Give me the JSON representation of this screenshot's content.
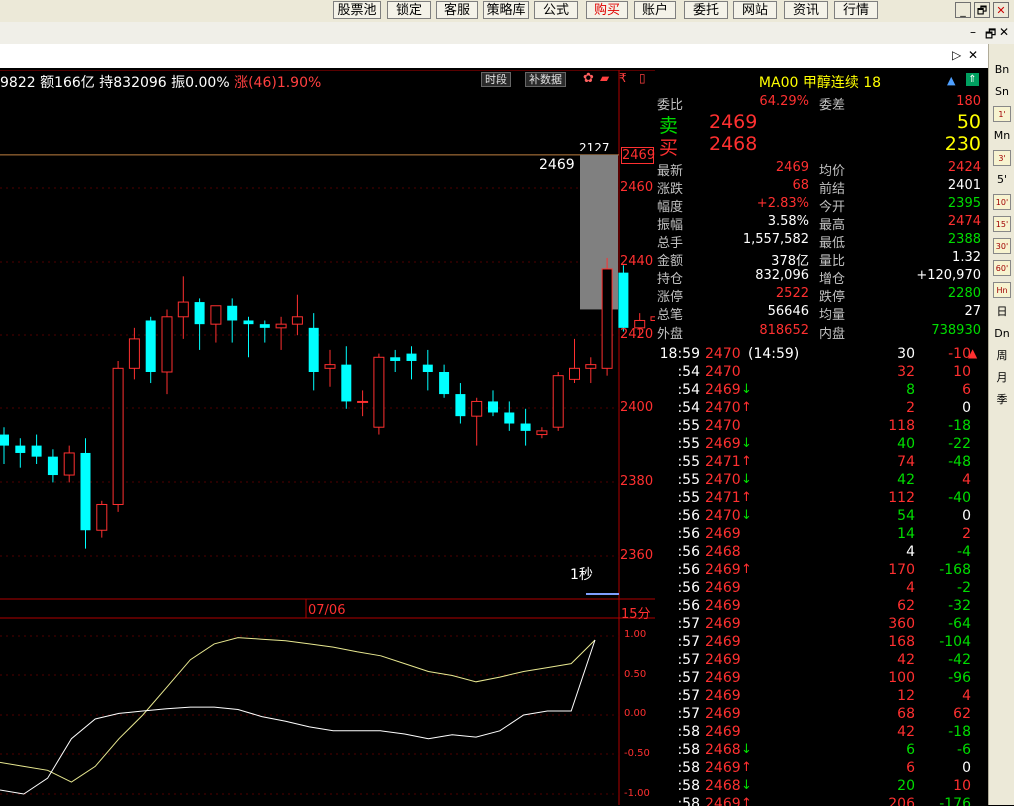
{
  "toolbar": {
    "buttons": [
      "股票池",
      "锁定",
      "客服",
      "策略库",
      "公式",
      "购买",
      "账户",
      "委托",
      "网站",
      "资讯",
      "行情"
    ],
    "active_color": "#e00000"
  },
  "window_controls": {
    "minimize": "_",
    "restore": "🗗",
    "close": "✕"
  },
  "panel_controls": {
    "play": "▷",
    "close": "✕"
  },
  "info_line": {
    "text": "9822 额166亿 持832096 振0.00%",
    "change": "涨(46)1.90%"
  },
  "chart_buttons": {
    "time_period": "时段",
    "supplement": "补数据"
  },
  "price_axis": [
    "2460",
    "2440",
    "2420",
    "2400",
    "2380",
    "2360"
  ],
  "current_price_tag": "2469",
  "price_label": "2469",
  "cut_label": "2127",
  "date_label": "07/06",
  "period_label": "15分",
  "interval_label": "1秒",
  "osc_axis": [
    "1.00",
    "0.50",
    "0.00",
    "-0.50",
    "-1.00"
  ],
  "chart_data": {
    "type": "candlestick",
    "candles": [
      {
        "o": 2393,
        "h": 2395,
        "l": 2385,
        "c": 2390
      },
      {
        "o": 2390,
        "h": 2392,
        "l": 2384,
        "c": 2388
      },
      {
        "o": 2390,
        "h": 2393,
        "l": 2385,
        "c": 2387
      },
      {
        "o": 2387,
        "h": 2389,
        "l": 2380,
        "c": 2382
      },
      {
        "o": 2382,
        "h": 2390,
        "l": 2380,
        "c": 2388
      },
      {
        "o": 2388,
        "h": 2392,
        "l": 2362,
        "c": 2367
      },
      {
        "o": 2367,
        "h": 2375,
        "l": 2365,
        "c": 2374
      },
      {
        "o": 2374,
        "h": 2413,
        "l": 2372,
        "c": 2411
      },
      {
        "o": 2411,
        "h": 2422,
        "l": 2408,
        "c": 2419
      },
      {
        "o": 2424,
        "h": 2425,
        "l": 2407,
        "c": 2410
      },
      {
        "o": 2410,
        "h": 2427,
        "l": 2404,
        "c": 2425
      },
      {
        "o": 2425,
        "h": 2436,
        "l": 2419,
        "c": 2429
      },
      {
        "o": 2429,
        "h": 2430,
        "l": 2416,
        "c": 2423
      },
      {
        "o": 2423,
        "h": 2428,
        "l": 2418,
        "c": 2428
      },
      {
        "o": 2428,
        "h": 2430,
        "l": 2418,
        "c": 2424
      },
      {
        "o": 2424,
        "h": 2425,
        "l": 2414,
        "c": 2423
      },
      {
        "o": 2423,
        "h": 2424,
        "l": 2418,
        "c": 2422
      },
      {
        "o": 2422,
        "h": 2425,
        "l": 2416,
        "c": 2423
      },
      {
        "o": 2423,
        "h": 2431,
        "l": 2420,
        "c": 2425
      },
      {
        "o": 2422,
        "h": 2426,
        "l": 2405,
        "c": 2410
      },
      {
        "o": 2411,
        "h": 2416,
        "l": 2406,
        "c": 2412
      },
      {
        "o": 2412,
        "h": 2417,
        "l": 2400,
        "c": 2402
      },
      {
        "o": 2402,
        "h": 2405,
        "l": 2398,
        "c": 2402
      },
      {
        "o": 2395,
        "h": 2415,
        "l": 2393,
        "c": 2414
      },
      {
        "o": 2414,
        "h": 2416,
        "l": 2410,
        "c": 2413
      },
      {
        "o": 2415,
        "h": 2417,
        "l": 2408,
        "c": 2413
      },
      {
        "o": 2412,
        "h": 2416,
        "l": 2405,
        "c": 2410
      },
      {
        "o": 2410,
        "h": 2412,
        "l": 2403,
        "c": 2404
      },
      {
        "o": 2404,
        "h": 2407,
        "l": 2396,
        "c": 2398
      },
      {
        "o": 2398,
        "h": 2403,
        "l": 2390,
        "c": 2402
      },
      {
        "o": 2402,
        "h": 2405,
        "l": 2398,
        "c": 2399
      },
      {
        "o": 2399,
        "h": 2402,
        "l": 2394,
        "c": 2396
      },
      {
        "o": 2396,
        "h": 2400,
        "l": 2390,
        "c": 2394
      },
      {
        "o": 2393,
        "h": 2395,
        "l": 2392,
        "c": 2394
      },
      {
        "o": 2395,
        "h": 2410,
        "l": 2394,
        "c": 2409
      },
      {
        "o": 2408,
        "h": 2419,
        "l": 2407,
        "c": 2411
      },
      {
        "o": 2411,
        "h": 2414,
        "l": 2407,
        "c": 2412
      },
      {
        "o": 2411,
        "h": 2441,
        "l": 2409,
        "c": 2438
      },
      {
        "o": 2437,
        "h": 2439,
        "l": 2421,
        "c": 2422
      },
      {
        "o": 2422,
        "h": 2426,
        "l": 2420,
        "c": 2424
      },
      {
        "o": 2424,
        "h": 2428,
        "l": 2420,
        "c": 2425
      },
      {
        "o": 2425,
        "h": 2426,
        "l": 2421,
        "c": 2422
      }
    ],
    "current_price": 2469,
    "oscillator": {
      "yellow_line": [
        -0.6,
        -0.65,
        -0.7,
        -0.85,
        -0.65,
        -0.3,
        0.0,
        0.35,
        0.7,
        0.9,
        0.98,
        0.96,
        0.94,
        0.9,
        0.86,
        0.8,
        0.75,
        0.65,
        0.55,
        0.5,
        0.42,
        0.48,
        0.55,
        0.6,
        0.65,
        0.95
      ],
      "white_line": [
        -0.95,
        -1.0,
        -0.8,
        -0.3,
        -0.05,
        0.02,
        0.05,
        0.08,
        0.1,
        0.1,
        0.07,
        -0.02,
        -0.08,
        -0.15,
        -0.2,
        -0.2,
        -0.2,
        -0.24,
        -0.3,
        -0.25,
        -0.28,
        -0.2,
        0.0,
        0.05,
        0.05,
        0.95
      ],
      "ylim": [
        -1.0,
        1.0
      ]
    }
  },
  "quote": {
    "title": "MA00  甲醇连续 18",
    "weibi_label": "委比",
    "weibi_value": "64.29%",
    "weicha_label": "委差",
    "weicha_value": "180",
    "sell_label": "卖",
    "sell_price": "2469",
    "sell_vol": "50",
    "buy_label": "买",
    "buy_price": "2468",
    "buy_vol": "230",
    "rows": [
      {
        "l1": "最新",
        "v1": "2469",
        "c1": "#ff3030",
        "l2": "均价",
        "v2": "2424",
        "c2": "#ff3030"
      },
      {
        "l1": "涨跌",
        "v1": "68",
        "c1": "#ff3030",
        "l2": "前结",
        "v2": "2401",
        "c2": "#ffffff"
      },
      {
        "l1": "幅度",
        "v1": "+2.83%",
        "c1": "#ff3030",
        "l2": "今开",
        "v2": "2395",
        "c2": "#00dd00"
      },
      {
        "l1": "振幅",
        "v1": "3.58%",
        "c1": "#ffffff",
        "l2": "最高",
        "v2": "2474",
        "c2": "#ff3030"
      },
      {
        "l1": "总手",
        "v1": "1,557,582",
        "c1": "#ffffff",
        "l2": "最低",
        "v2": "2388",
        "c2": "#00dd00"
      },
      {
        "l1": "金额",
        "v1": "378亿",
        "c1": "#ffffff",
        "l2": "量比",
        "v2": "1.32",
        "c2": "#ffffff"
      },
      {
        "l1": "持仓",
        "v1": "832,096",
        "c1": "#ffffff",
        "l2": "增仓",
        "v2": "+120,970",
        "c2": "#ffffff"
      },
      {
        "l1": "涨停",
        "v1": "2522",
        "c1": "#ff3030",
        "l2": "跌停",
        "v2": "2280",
        "c2": "#00dd00"
      },
      {
        "l1": "总笔",
        "v1": "56646",
        "c1": "#ffffff",
        "l2": "均量",
        "v2": "27",
        "c2": "#ffffff"
      }
    ],
    "outer_label": "外盘",
    "outer_value": "818652",
    "inner_label": "内盘",
    "inner_value": "738930"
  },
  "ticks": [
    {
      "t": "18:59",
      "p": "2470",
      "extra": "(14:59)",
      "v": "30",
      "o": "-10",
      "vc": "#ffffff",
      "oc": "#ff3030"
    },
    {
      "t": ":54",
      "p": "2470",
      "a": "",
      "v": "32",
      "o": "10",
      "vc": "#ff3030",
      "oc": "#ff3030"
    },
    {
      "t": ":54",
      "p": "2469",
      "a": "↓",
      "v": "8",
      "o": "6",
      "vc": "#00dd00",
      "oc": "#ff3030"
    },
    {
      "t": ":54",
      "p": "2470",
      "a": "↑",
      "v": "2",
      "o": "0",
      "vc": "#ff3030",
      "oc": "#ffffff"
    },
    {
      "t": ":55",
      "p": "2470",
      "a": "",
      "v": "118",
      "o": "-18",
      "vc": "#ff3030",
      "oc": "#00dd00"
    },
    {
      "t": ":55",
      "p": "2469",
      "a": "↓",
      "v": "40",
      "o": "-22",
      "vc": "#00dd00",
      "oc": "#00dd00"
    },
    {
      "t": ":55",
      "p": "2471",
      "a": "↑",
      "v": "74",
      "o": "-48",
      "vc": "#ff3030",
      "oc": "#00dd00"
    },
    {
      "t": ":55",
      "p": "2470",
      "a": "↓",
      "v": "42",
      "o": "4",
      "vc": "#00dd00",
      "oc": "#ff3030"
    },
    {
      "t": ":55",
      "p": "2471",
      "a": "↑",
      "v": "112",
      "o": "-40",
      "vc": "#ff3030",
      "oc": "#00dd00"
    },
    {
      "t": ":56",
      "p": "2470",
      "a": "↓",
      "v": "54",
      "o": "0",
      "vc": "#00dd00",
      "oc": "#ffffff"
    },
    {
      "t": ":56",
      "p": "2469",
      "a": "",
      "v": "14",
      "o": "2",
      "vc": "#00dd00",
      "oc": "#ff3030"
    },
    {
      "t": ":56",
      "p": "2468",
      "a": "",
      "v": "4",
      "o": "-4",
      "vc": "#ffffff",
      "oc": "#00dd00"
    },
    {
      "t": ":56",
      "p": "2469",
      "a": "↑",
      "v": "170",
      "o": "-168",
      "vc": "#ff3030",
      "oc": "#00dd00"
    },
    {
      "t": ":56",
      "p": "2469",
      "a": "",
      "v": "4",
      "o": "-2",
      "vc": "#ff3030",
      "oc": "#00dd00"
    },
    {
      "t": ":56",
      "p": "2469",
      "a": "",
      "v": "62",
      "o": "-32",
      "vc": "#ff3030",
      "oc": "#00dd00"
    },
    {
      "t": ":57",
      "p": "2469",
      "a": "",
      "v": "360",
      "o": "-64",
      "vc": "#ff3030",
      "oc": "#00dd00"
    },
    {
      "t": ":57",
      "p": "2469",
      "a": "",
      "v": "168",
      "o": "-104",
      "vc": "#ff3030",
      "oc": "#00dd00"
    },
    {
      "t": ":57",
      "p": "2469",
      "a": "",
      "v": "42",
      "o": "-42",
      "vc": "#ff3030",
      "oc": "#00dd00"
    },
    {
      "t": ":57",
      "p": "2469",
      "a": "",
      "v": "100",
      "o": "-96",
      "vc": "#ff3030",
      "oc": "#00dd00"
    },
    {
      "t": ":57",
      "p": "2469",
      "a": "",
      "v": "12",
      "o": "4",
      "vc": "#ff3030",
      "oc": "#ff3030"
    },
    {
      "t": ":57",
      "p": "2469",
      "a": "",
      "v": "68",
      "o": "62",
      "vc": "#ff3030",
      "oc": "#ff3030"
    },
    {
      "t": ":58",
      "p": "2469",
      "a": "",
      "v": "42",
      "o": "-18",
      "vc": "#ff3030",
      "oc": "#00dd00"
    },
    {
      "t": ":58",
      "p": "2468",
      "a": "↓",
      "v": "6",
      "o": "-6",
      "vc": "#00dd00",
      "oc": "#00dd00"
    },
    {
      "t": ":58",
      "p": "2469",
      "a": "↑",
      "v": "6",
      "o": "0",
      "vc": "#ff3030",
      "oc": "#ffffff"
    },
    {
      "t": ":58",
      "p": "2468",
      "a": "↓",
      "v": "20",
      "o": "10",
      "vc": "#00dd00",
      "oc": "#ff3030"
    },
    {
      "t": ":58",
      "p": "2469",
      "a": "↑",
      "v": "206",
      "o": "-176",
      "vc": "#ff3030",
      "oc": "#00dd00"
    }
  ],
  "right_sidebar": [
    "Bn",
    "Sn",
    "1'",
    "Mn",
    "3'",
    "5'",
    "10'",
    "15'",
    "30'",
    "60'",
    "Hn",
    "日",
    "Dn",
    "周",
    "月",
    "季"
  ],
  "colors": {
    "up": "#ff3030",
    "down": "#00dd00",
    "cyan": "#00ffff",
    "yellow": "#ffff00"
  }
}
